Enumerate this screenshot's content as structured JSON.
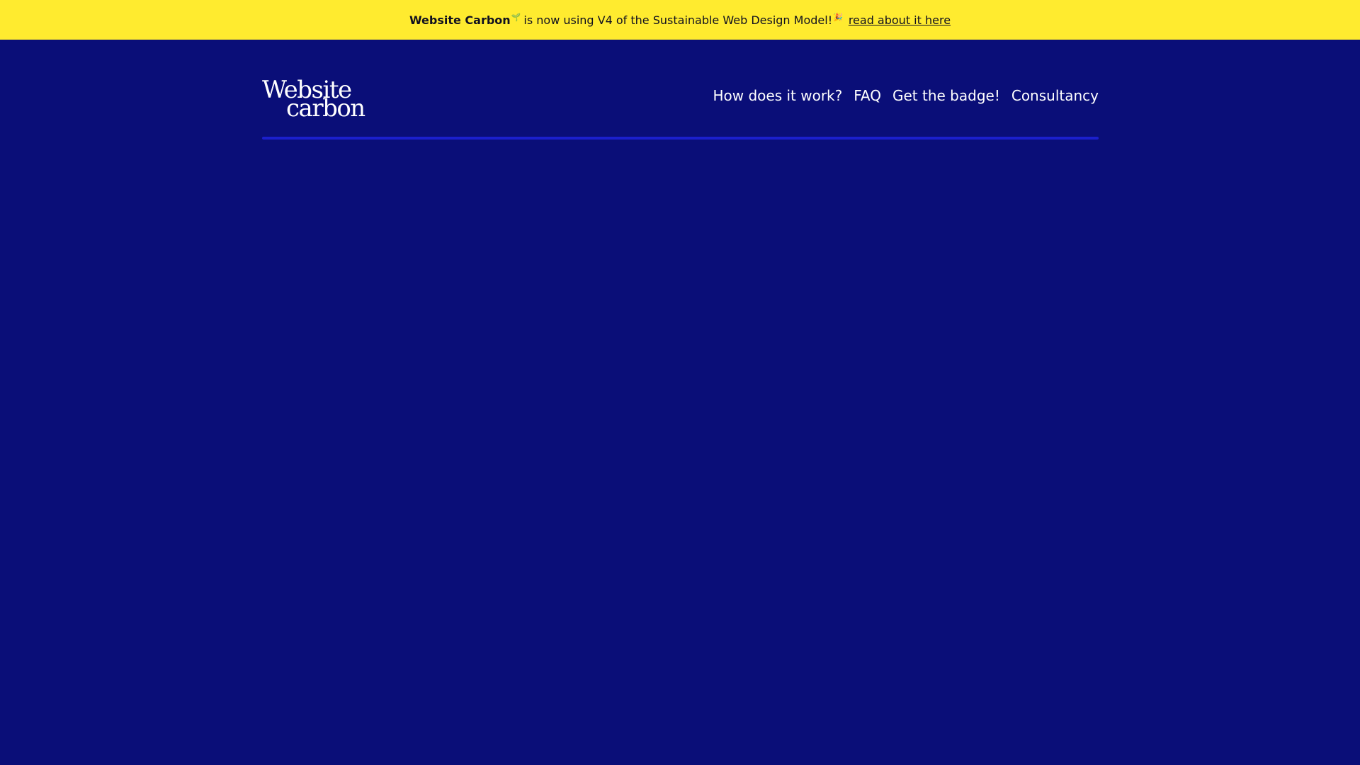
{
  "banner": {
    "brand": "Website Carbon",
    "glyph_1": "🌱",
    "message": "is now using V4 of the Sustainable Web Design Model!",
    "glyph_2": "🎉",
    "link_label": "read about it here"
  },
  "header": {
    "logo_line1": "Website",
    "logo_line2": "carbon",
    "nav": [
      {
        "label": "How does it work?"
      },
      {
        "label": "FAQ"
      },
      {
        "label": "Get the badge!"
      },
      {
        "label": "Consultancy"
      }
    ]
  },
  "colors": {
    "banner_bg": "#ffeb2f",
    "page_bg": "#0a0e78",
    "rule": "#1b1fcc"
  }
}
